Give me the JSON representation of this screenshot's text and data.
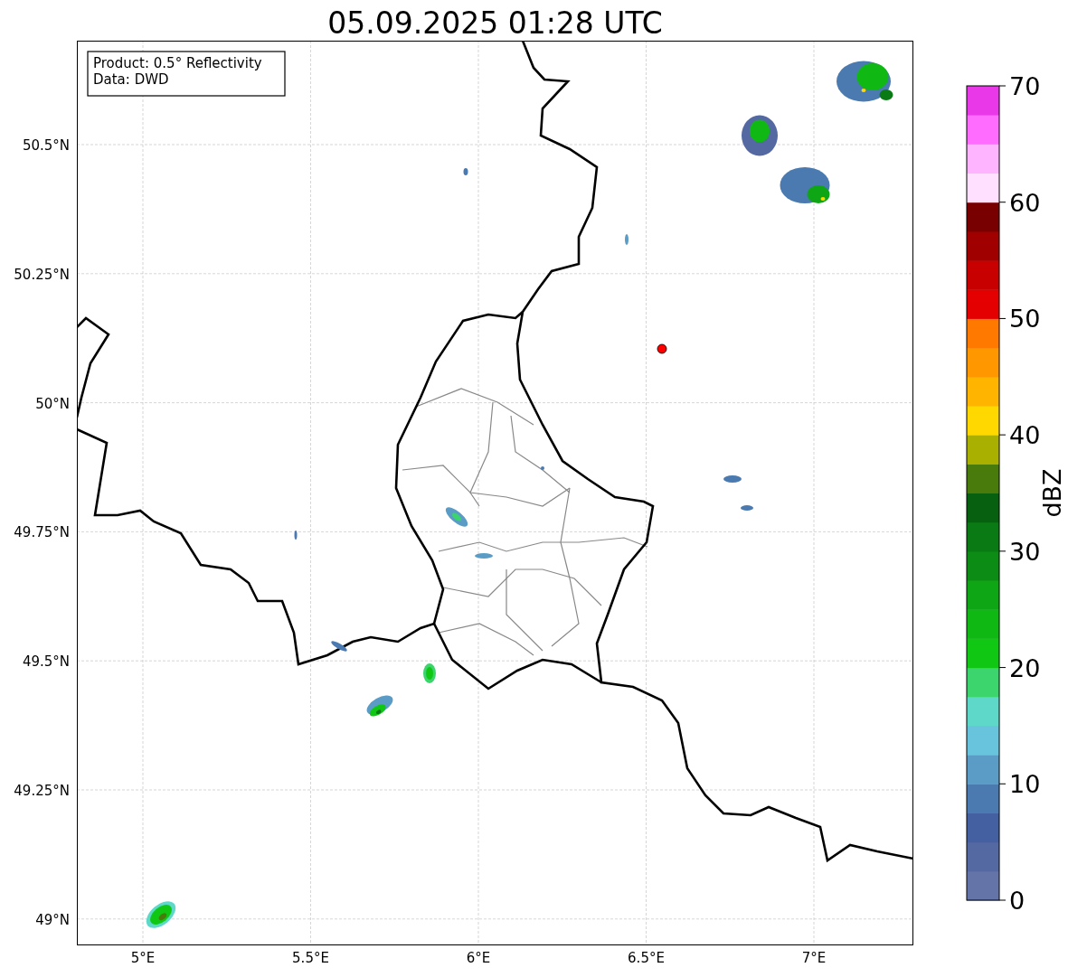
{
  "title": "05.09.2025 01:28 UTC",
  "legend": [
    "Product: 0.5° Reflectivity",
    "Data: DWD"
  ],
  "map": {
    "xticks": [
      "5°E",
      "5.5°E",
      "6°E",
      "6.5°E",
      "7°E"
    ],
    "yticks": [
      "50.5°N",
      "50.25°N",
      "50°N",
      "49.75°N",
      "49.5°N",
      "49.25°N",
      "49°N"
    ]
  },
  "colorbar": {
    "label": "dBZ",
    "ticks": [
      "70",
      "60",
      "50",
      "40",
      "30",
      "20",
      "10",
      "0"
    ]
  }
}
